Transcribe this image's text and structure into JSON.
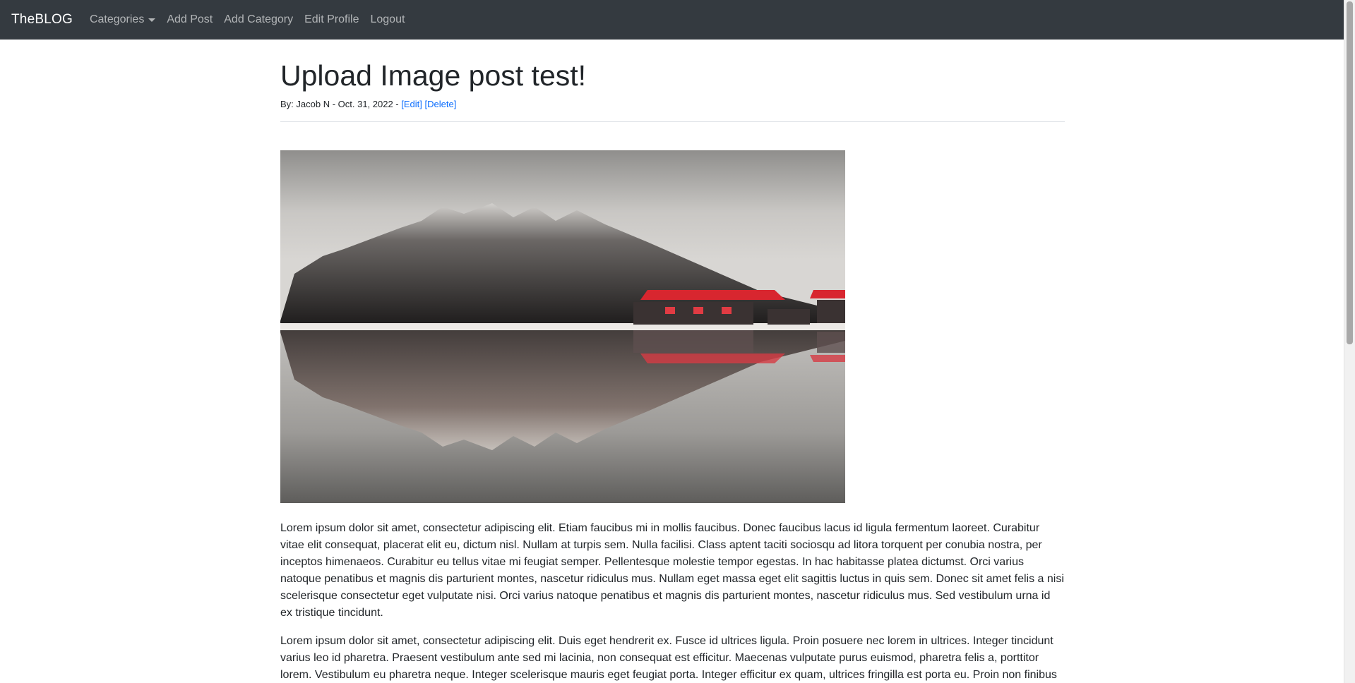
{
  "nav": {
    "brand": "TheBLOG",
    "links": [
      "Categories",
      "Add Post",
      "Add Category",
      "Edit Profile",
      "Logout"
    ]
  },
  "post": {
    "title": "Upload Image post test!",
    "meta_prefix": "By: Jacob N - Oct. 31, 2022 - ",
    "edit_label": "[Edit]",
    "delete_label": "[Delete]",
    "paragraphs": [
      "Lorem ipsum dolor sit amet, consectetur adipiscing elit. Etiam faucibus mi in mollis faucibus. Donec faucibus lacus id ligula fermentum laoreet. Curabitur vitae elit consequat, placerat elit eu, dictum nisl. Nullam at turpis sem. Nulla facilisi. Class aptent taciti sociosqu ad litora torquent per conubia nostra, per inceptos himenaeos. Curabitur eu tellus vitae mi feugiat semper. Pellentesque molestie tempor egestas. In hac habitasse platea dictumst. Orci varius natoque penatibus et magnis dis parturient montes, nascetur ridiculus mus. Nullam eget massa eget elit sagittis luctus in quis sem. Donec sit amet felis a nisi scelerisque consectetur eget vulputate nisi. Orci varius natoque penatibus et magnis dis parturient montes, nascetur ridiculus mus. Sed vestibulum urna id ex tristique tincidunt.",
      "Lorem ipsum dolor sit amet, consectetur adipiscing elit. Duis eget hendrerit ex. Fusce id ultrices ligula. Proin posuere nec lorem in ultrices. Integer tincidunt varius leo id pharetra. Praesent vestibulum ante sed mi lacinia, non consequat est efficitur. Maecenas vulputate purus euismod, pharetra felis a, porttitor lorem. Vestibulum eu pharetra neque. Integer scelerisque mauris eget feugiat porta. Integer efficitur ex quam, ultrices fringilla est porta eu. Proin non finibus"
    ]
  },
  "colors": {
    "navbar": "#343a40",
    "link": "#0d6efd",
    "text": "#212529"
  }
}
